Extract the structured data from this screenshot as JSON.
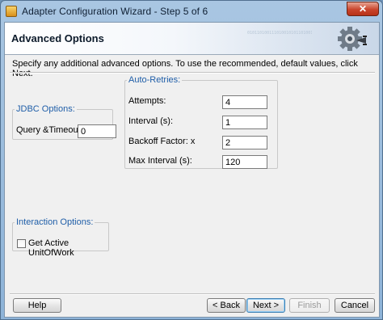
{
  "window": {
    "title": "Adapter Configuration Wizard - Step 5 of 6",
    "close_glyph": "✕"
  },
  "header": {
    "title": "Advanced Options",
    "watermark": "0101101001110100101011010011101001010110100111010010101101001110100101011010011101001010"
  },
  "instructions": "Specify any additional advanced options.  To use the recommended, default values, click Next.",
  "jdbc_options": {
    "legend": "JDBC Options:",
    "query_timeout_label": "Query &Timeout:",
    "query_timeout_value": "0"
  },
  "auto_retries": {
    "legend": "Auto-Retries:",
    "attempts_label": "Attempts:",
    "attempts_value": "4",
    "interval_label": "Interval (s):",
    "interval_value": "1",
    "backoff_label": "Backoff Factor: x",
    "backoff_value": "2",
    "max_interval_label": "Max Interval (s):",
    "max_interval_value": "120"
  },
  "interaction_options": {
    "legend": "Interaction Options:",
    "get_active_uow_label": "Get Active UnitOfWork",
    "get_active_uow_checked": false
  },
  "footer": {
    "help_label": "Help",
    "back_label": "< Back",
    "next_label": "Next >",
    "finish_label": "Finish",
    "cancel_label": "Cancel"
  },
  "icons": {
    "app": "wizard-app-icon",
    "header": "gear-plug-icon"
  }
}
